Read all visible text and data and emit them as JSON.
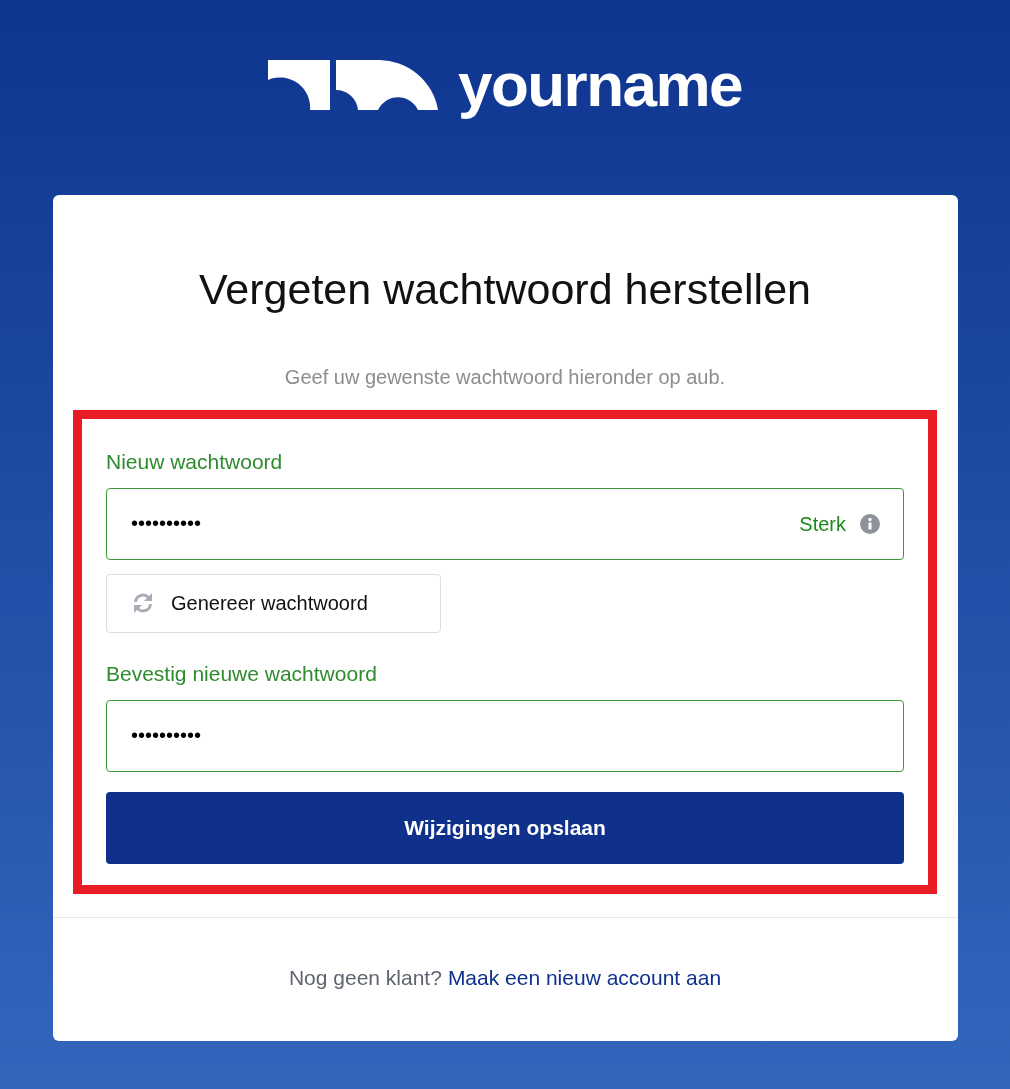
{
  "logo": {
    "text": "yourname"
  },
  "card": {
    "title": "Vergeten wachtwoord herstellen",
    "subtitle": "Geef uw gewenste wachtwoord hieronder op aub.",
    "highlighted": true
  },
  "form": {
    "new_password": {
      "label": "Nieuw wachtwoord",
      "value": "••••••••••",
      "strength": "Sterk"
    },
    "generate_button": "Genereer wachtwoord",
    "confirm_password": {
      "label": "Bevestig nieuwe wachtwoord",
      "value": "••••••••••"
    },
    "save_button": "Wijzigingen opslaan"
  },
  "footer": {
    "text": "Nog geen klant?",
    "link": "Maak een nieuw account aan"
  }
}
